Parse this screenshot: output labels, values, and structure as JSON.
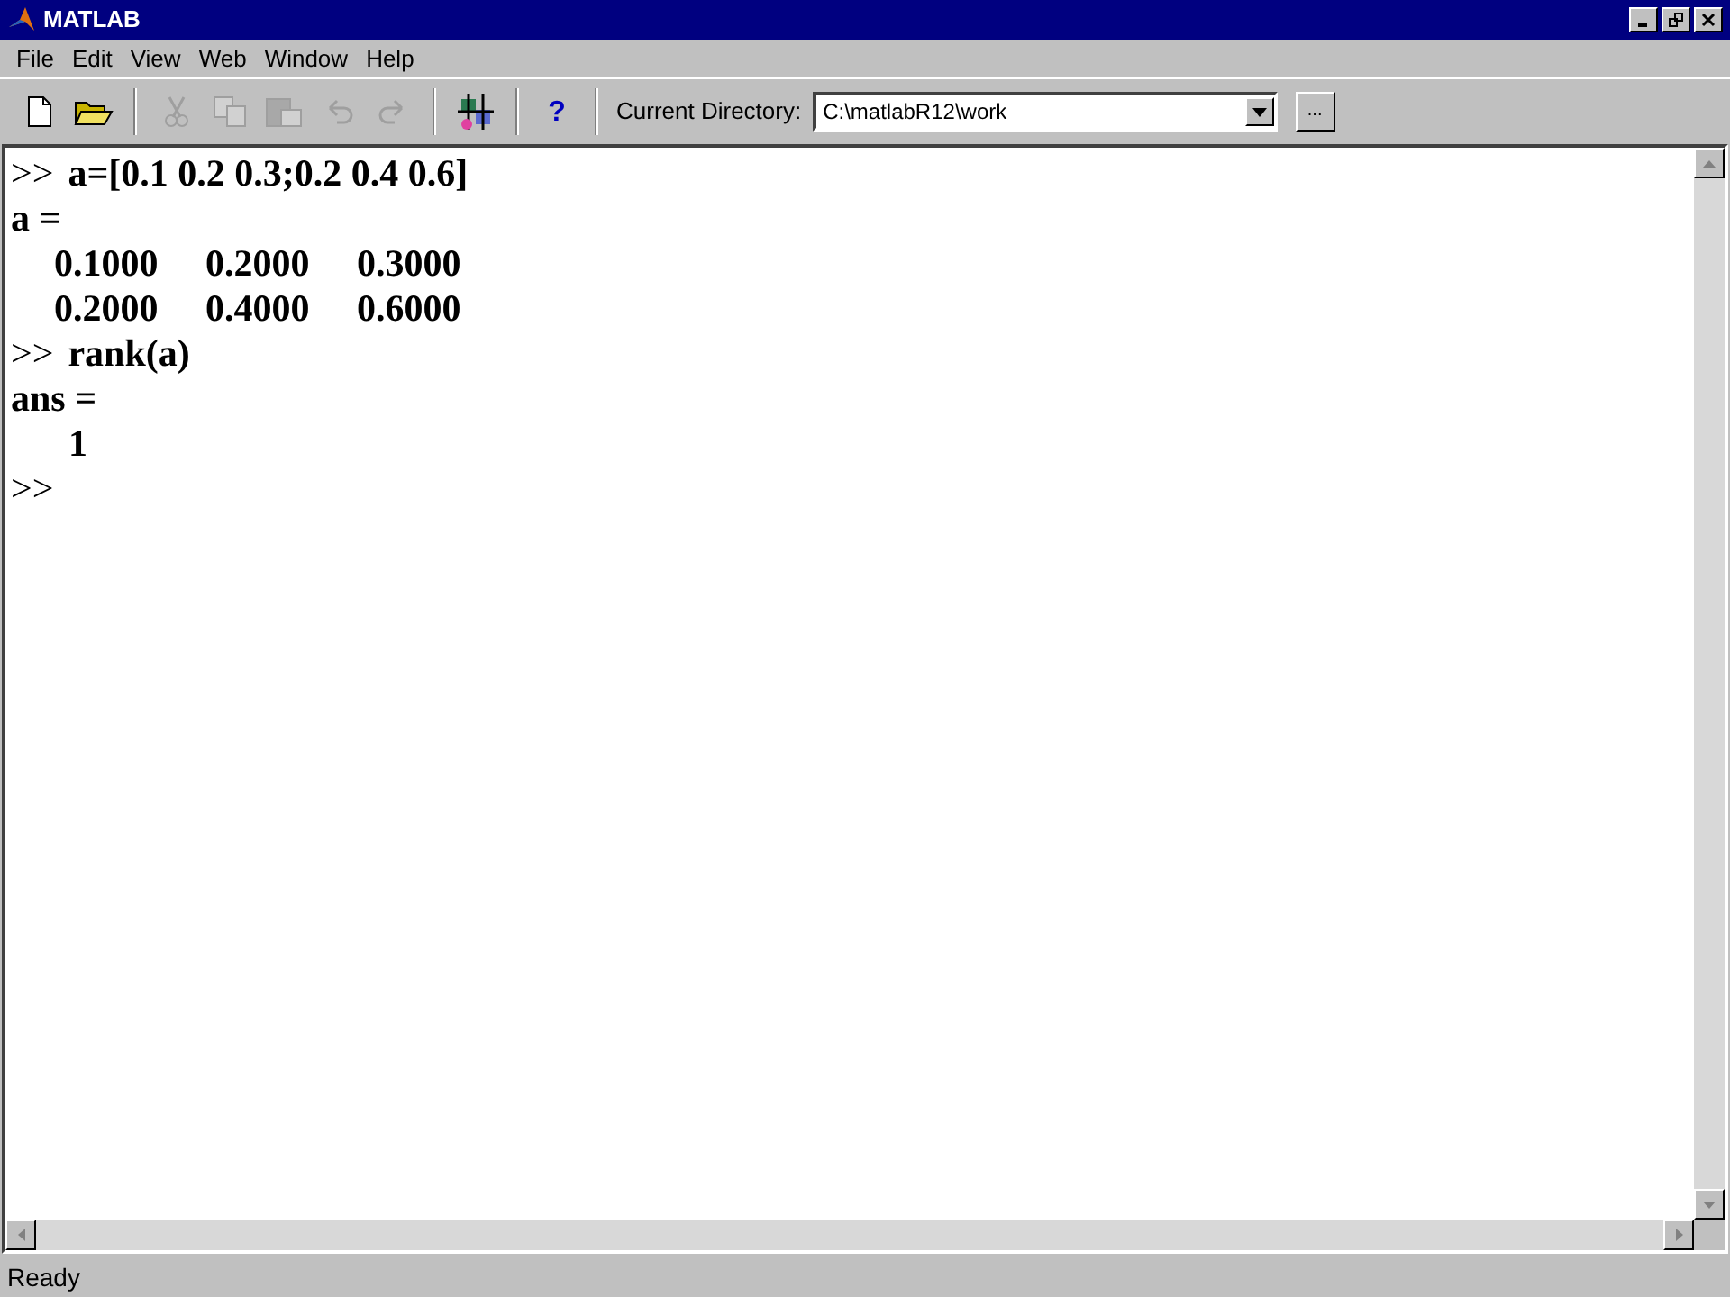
{
  "window": {
    "title": "MATLAB"
  },
  "menu": [
    "File",
    "Edit",
    "View",
    "Web",
    "Window",
    "Help"
  ],
  "toolbar": [
    {
      "kind": "new",
      "disabled": false
    },
    {
      "kind": "open",
      "disabled": false
    },
    {
      "kind": "sep"
    },
    {
      "kind": "cut",
      "disabled": true
    },
    {
      "kind": "copy",
      "disabled": true
    },
    {
      "kind": "paste",
      "disabled": true
    },
    {
      "kind": "undo",
      "disabled": true
    },
    {
      "kind": "redo",
      "disabled": true
    },
    {
      "kind": "sep"
    },
    {
      "kind": "simulink",
      "disabled": false
    },
    {
      "kind": "sep"
    },
    {
      "kind": "help",
      "label": "?",
      "disabled": false
    },
    {
      "kind": "sep"
    }
  ],
  "current_directory": {
    "label": "Current Directory:",
    "value": "C:\\matlabR12\\work",
    "browse": "..."
  },
  "console": [
    {
      "kind": "input",
      "prompt": ">>",
      "command": "a=[0.1 0.2 0.3;0.2 0.4 0.6]"
    },
    {
      "kind": "output",
      "text": "a ="
    },
    {
      "kind": "row",
      "values": [
        "0.1000",
        "0.2000",
        "0.3000"
      ]
    },
    {
      "kind": "row",
      "values": [
        "0.2000",
        "0.4000",
        "0.6000"
      ]
    },
    {
      "kind": "input",
      "prompt": ">>",
      "command": "rank(a)"
    },
    {
      "kind": "output",
      "text": "ans ="
    },
    {
      "kind": "row",
      "values": [
        "1"
      ]
    },
    {
      "kind": "input",
      "prompt": ">>"
    }
  ],
  "status_bar": "Ready"
}
